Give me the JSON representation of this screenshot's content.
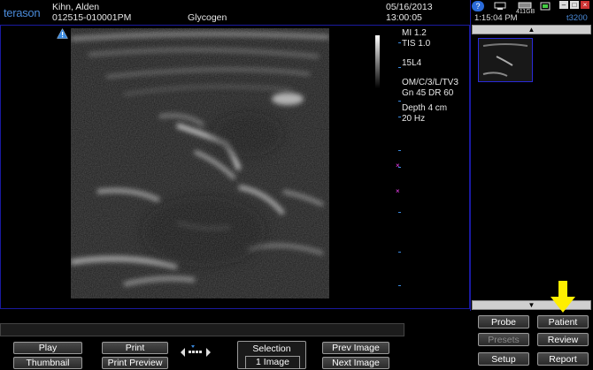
{
  "header": {
    "logo": "terason",
    "patient_name": "Kihn, Alden",
    "patient_id": "012515-010001PM",
    "study": "Glycogen",
    "date": "05/16/2013",
    "time": "13:00:05"
  },
  "system": {
    "clock": "1:15:04 PM",
    "disk": "411GB",
    "model": "t3200"
  },
  "scan_params": {
    "mi": "MI  1.2",
    "tis": "TIS 1.0",
    "probe": "15L4",
    "preset": "OM/C/3/L/TV3",
    "gain": "Gn 45   DR 60",
    "depth": "Depth 4 cm",
    "frame_rate": "20 Hz"
  },
  "buttons": {
    "play": "Play",
    "thumbnail": "Thumbnail",
    "print": "Print",
    "print_preview": "Print Preview",
    "selection": "Selection",
    "selection_count": "1 Image",
    "prev_image": "Prev Image",
    "next_image": "Next Image",
    "probe": "Probe",
    "patient": "Patient",
    "presets": "Presets",
    "review": "Review",
    "setup": "Setup",
    "report": "Report"
  },
  "colors": {
    "accent_blue": "#1a1aa0",
    "logo_blue": "#4a8ad8",
    "arrow_yellow": "#ffee00",
    "marker_magenta": "#ff44ff"
  }
}
